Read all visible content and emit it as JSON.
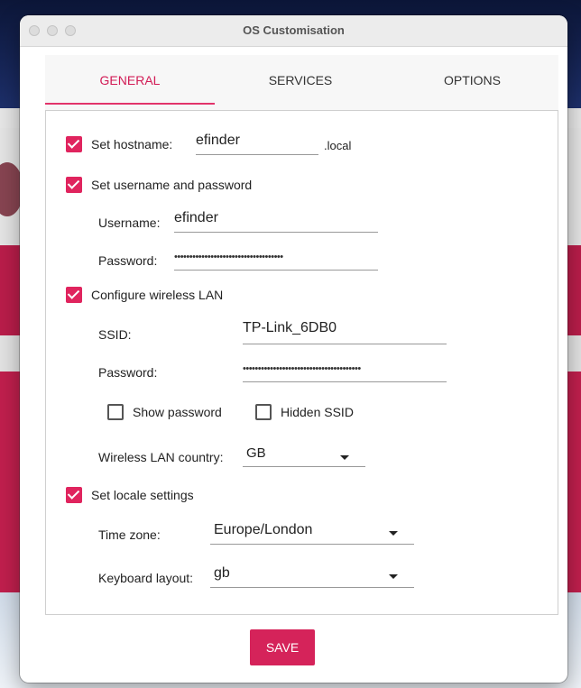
{
  "window": {
    "title": "OS Customisation"
  },
  "tabs": [
    {
      "label": "GENERAL"
    },
    {
      "label": "SERVICES"
    },
    {
      "label": "OPTIONS"
    }
  ],
  "hostname": {
    "label": "Set hostname:",
    "value": "efinder",
    "suffix": ".local",
    "checked": true
  },
  "user": {
    "label": "Set username and password",
    "checked": true,
    "username_label": "Username:",
    "username_value": "efinder",
    "password_label": "Password:",
    "password_value": "••••••••••••••••••••••••••••••••••••"
  },
  "wifi": {
    "label": "Configure wireless LAN",
    "checked": true,
    "ssid_label": "SSID:",
    "ssid_value": "TP-Link_6DB0",
    "password_label": "Password:",
    "password_value": "•••••••••••••••••••••••••••••••••••••••",
    "show_password_label": "Show password",
    "show_password_checked": false,
    "hidden_ssid_label": "Hidden SSID",
    "hidden_ssid_checked": false,
    "country_label": "Wireless LAN country:",
    "country_value": "GB"
  },
  "locale": {
    "label": "Set locale settings",
    "checked": true,
    "timezone_label": "Time zone:",
    "timezone_value": "Europe/London",
    "keyboard_label": "Keyboard layout:",
    "keyboard_value": "gb"
  },
  "actions": {
    "save_label": "SAVE"
  },
  "colors": {
    "accent": "#e0245e",
    "save": "#d5235a"
  }
}
